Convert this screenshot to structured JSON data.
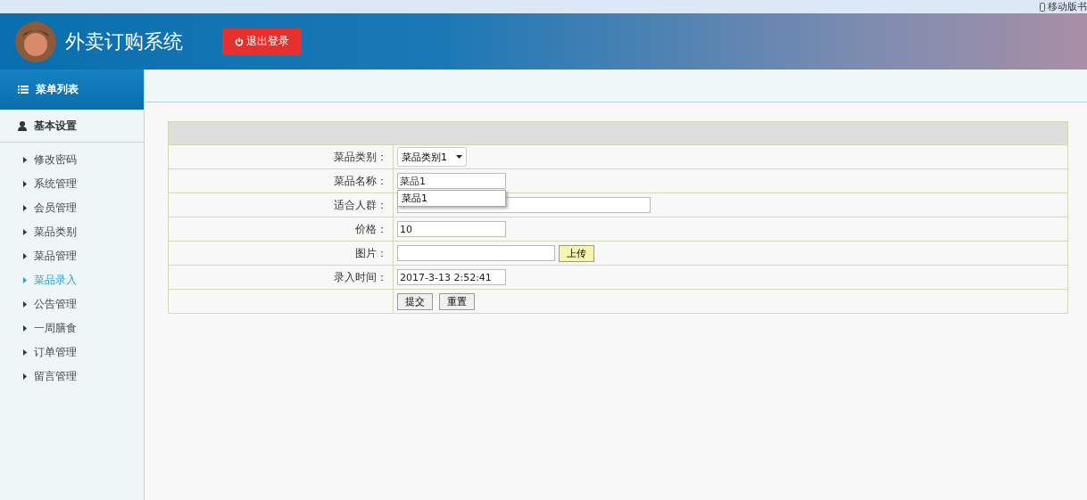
{
  "browser_bar": {
    "bookmark": "移动版书"
  },
  "header": {
    "title": "外卖订购系统",
    "logout": "退出登录"
  },
  "sidebar": {
    "title": "菜单列表",
    "section": "基本设置",
    "items": [
      {
        "label": "修改密码",
        "selected": false
      },
      {
        "label": "系统管理",
        "selected": false
      },
      {
        "label": "会员管理",
        "selected": false
      },
      {
        "label": "菜品类别",
        "selected": false
      },
      {
        "label": "菜品管理",
        "selected": false
      },
      {
        "label": "菜品录入",
        "selected": true
      },
      {
        "label": "公告管理",
        "selected": false
      },
      {
        "label": "一周膳食",
        "selected": false
      },
      {
        "label": "订单管理",
        "selected": false
      },
      {
        "label": "留言管理",
        "selected": false
      }
    ]
  },
  "form": {
    "rows": [
      {
        "kind": "select",
        "label": "菜品类别：",
        "value": "菜品类别1"
      },
      {
        "kind": "text",
        "label": "菜品名称：",
        "value": "菜品1",
        "suggestion": "菜品1"
      },
      {
        "kind": "wide",
        "label": "适合人群："
      },
      {
        "kind": "text",
        "label": "价格：",
        "value": "10"
      },
      {
        "kind": "upload",
        "label": "图片：",
        "button": "上传"
      },
      {
        "kind": "text",
        "label": "录入时间：",
        "value": "2017-3-13 2:52:41"
      }
    ],
    "buttons": [
      "提交",
      "重置"
    ]
  }
}
